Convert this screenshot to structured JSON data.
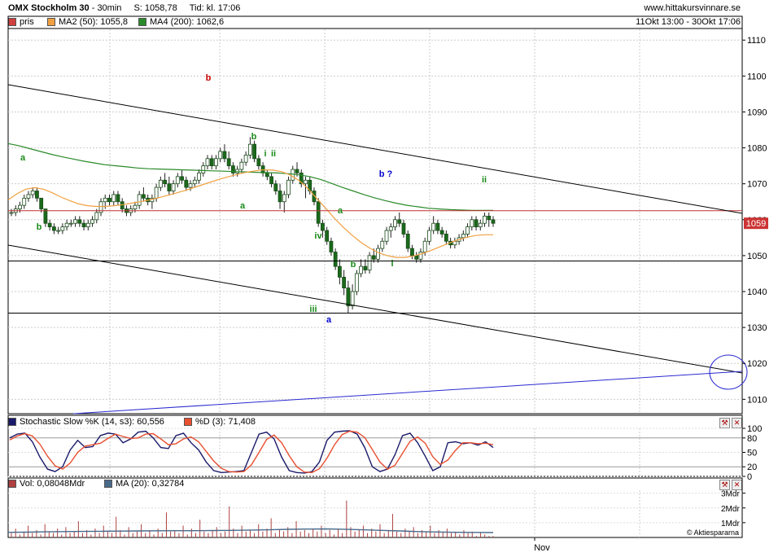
{
  "header": {
    "instrument": "OMX Stockholm 30",
    "interval": "30min",
    "last": "S: 1058,78",
    "time": "Tid: kl. 17:06",
    "site": "www.hittakursvinnare.se",
    "range": "11Okt 13:00 - 30Okt 17:06"
  },
  "legend": {
    "price": {
      "label": "pris",
      "color": "#cc3333"
    },
    "ma50": {
      "label": "MA2 (50): 1055,8",
      "color": "#f0a040"
    },
    "ma200": {
      "label": "MA4 (200): 1062,6",
      "color": "#2a8a2a"
    }
  },
  "price_badge": "1059",
  "stoch_legend": {
    "k": "Stochastic Slow %K (14, s3): 60,556",
    "d": "%D (3): 71,408"
  },
  "vol_legend": {
    "vol": "Vol: 0,08048Mdr",
    "ma": "MA (20): 0,32784"
  },
  "x_label": "Nov",
  "credit": "© Aktiespararna",
  "icons": {
    "settings": "wrench-icon",
    "close": "close-icon"
  },
  "chart_data": [
    {
      "type": "candlestick",
      "title": "OMX Stockholm 30",
      "ylim": [
        1006,
        1113
      ],
      "yticks": [
        1010,
        1020,
        1030,
        1040,
        1050,
        1060,
        1070,
        1080,
        1090,
        1100,
        1110
      ],
      "grid": true,
      "x_tick_labels": [
        "Nov"
      ],
      "candles": [
        [
          1062,
          1063,
          1061,
          1062
        ],
        [
          1062,
          1064,
          1061,
          1063
        ],
        [
          1063,
          1065,
          1062,
          1064
        ],
        [
          1064,
          1067,
          1063,
          1066
        ],
        [
          1066,
          1068,
          1065,
          1067
        ],
        [
          1067,
          1069,
          1066,
          1068
        ],
        [
          1068,
          1069,
          1065,
          1066
        ],
        [
          1066,
          1066,
          1062,
          1063
        ],
        [
          1063,
          1063,
          1058,
          1059
        ],
        [
          1059,
          1060,
          1057,
          1058
        ],
        [
          1058,
          1059,
          1056,
          1057
        ],
        [
          1057,
          1058,
          1056,
          1057
        ],
        [
          1057,
          1059,
          1056,
          1058
        ],
        [
          1058,
          1060,
          1057,
          1059
        ],
        [
          1059,
          1060,
          1058,
          1059
        ],
        [
          1059,
          1061,
          1058,
          1060
        ],
        [
          1060,
          1061,
          1058,
          1059
        ],
        [
          1059,
          1060,
          1057,
          1058
        ],
        [
          1058,
          1060,
          1057,
          1059
        ],
        [
          1059,
          1061,
          1058,
          1060
        ],
        [
          1060,
          1063,
          1059,
          1062
        ],
        [
          1062,
          1066,
          1061,
          1065
        ],
        [
          1065,
          1067,
          1063,
          1066
        ],
        [
          1066,
          1067,
          1064,
          1065
        ],
        [
          1065,
          1068,
          1064,
          1067
        ],
        [
          1067,
          1068,
          1064,
          1065
        ],
        [
          1065,
          1066,
          1062,
          1063
        ],
        [
          1063,
          1064,
          1061,
          1062
        ],
        [
          1062,
          1064,
          1061,
          1063
        ],
        [
          1063,
          1065,
          1062,
          1064
        ],
        [
          1064,
          1068,
          1063,
          1067
        ],
        [
          1067,
          1069,
          1065,
          1066
        ],
        [
          1066,
          1067,
          1064,
          1065
        ],
        [
          1065,
          1067,
          1063,
          1066
        ],
        [
          1066,
          1070,
          1065,
          1069
        ],
        [
          1069,
          1072,
          1068,
          1071
        ],
        [
          1071,
          1073,
          1069,
          1070
        ],
        [
          1070,
          1072,
          1067,
          1068
        ],
        [
          1068,
          1071,
          1067,
          1070
        ],
        [
          1070,
          1073,
          1069,
          1072
        ],
        [
          1072,
          1074,
          1070,
          1071
        ],
        [
          1071,
          1072,
          1068,
          1069
        ],
        [
          1069,
          1071,
          1068,
          1070
        ],
        [
          1070,
          1072,
          1069,
          1071
        ],
        [
          1071,
          1074,
          1070,
          1073
        ],
        [
          1073,
          1076,
          1072,
          1075
        ],
        [
          1075,
          1078,
          1074,
          1077
        ],
        [
          1077,
          1078,
          1074,
          1075
        ],
        [
          1075,
          1078,
          1074,
          1077
        ],
        [
          1077,
          1080,
          1076,
          1079
        ],
        [
          1079,
          1081,
          1076,
          1077
        ],
        [
          1077,
          1079,
          1074,
          1075
        ],
        [
          1075,
          1076,
          1072,
          1073
        ],
        [
          1073,
          1075,
          1072,
          1074
        ],
        [
          1074,
          1077,
          1073,
          1076
        ],
        [
          1076,
          1079,
          1075,
          1078
        ],
        [
          1078,
          1083,
          1077,
          1081
        ],
        [
          1081,
          1082,
          1076,
          1077
        ],
        [
          1077,
          1078,
          1074,
          1075
        ],
        [
          1075,
          1076,
          1072,
          1073
        ],
        [
          1073,
          1074,
          1071,
          1072
        ],
        [
          1072,
          1073,
          1069,
          1070
        ],
        [
          1070,
          1071,
          1067,
          1068
        ],
        [
          1068,
          1070,
          1063,
          1065
        ],
        [
          1065,
          1068,
          1062,
          1067
        ],
        [
          1067,
          1072,
          1066,
          1071
        ],
        [
          1071,
          1075,
          1070,
          1074
        ],
        [
          1074,
          1076,
          1072,
          1073
        ],
        [
          1073,
          1074,
          1069,
          1070
        ],
        [
          1070,
          1072,
          1066,
          1071
        ],
        [
          1071,
          1072,
          1067,
          1068
        ],
        [
          1068,
          1069,
          1064,
          1065
        ],
        [
          1065,
          1066,
          1058,
          1059
        ],
        [
          1059,
          1060,
          1055,
          1057
        ],
        [
          1057,
          1058,
          1053,
          1054
        ],
        [
          1054,
          1055,
          1050,
          1051
        ],
        [
          1051,
          1052,
          1046,
          1047
        ],
        [
          1047,
          1049,
          1042,
          1044
        ],
        [
          1044,
          1046,
          1039,
          1041
        ],
        [
          1041,
          1043,
          1034,
          1036
        ],
        [
          1036,
          1042,
          1035,
          1040
        ],
        [
          1040,
          1046,
          1039,
          1045
        ],
        [
          1045,
          1049,
          1044,
          1047
        ],
        [
          1047,
          1049,
          1045,
          1046
        ],
        [
          1046,
          1051,
          1045,
          1050
        ],
        [
          1050,
          1052,
          1048,
          1049
        ],
        [
          1049,
          1053,
          1048,
          1052
        ],
        [
          1052,
          1055,
          1051,
          1054
        ],
        [
          1054,
          1058,
          1053,
          1057
        ],
        [
          1057,
          1059,
          1055,
          1058
        ],
        [
          1058,
          1061,
          1057,
          1060
        ],
        [
          1060,
          1062,
          1058,
          1059
        ],
        [
          1059,
          1060,
          1055,
          1056
        ],
        [
          1056,
          1057,
          1051,
          1052
        ],
        [
          1052,
          1053,
          1049,
          1050
        ],
        [
          1050,
          1051,
          1048,
          1049
        ],
        [
          1049,
          1052,
          1048,
          1051
        ],
        [
          1051,
          1055,
          1050,
          1054
        ],
        [
          1054,
          1058,
          1053,
          1057
        ],
        [
          1057,
          1061,
          1056,
          1059
        ],
        [
          1059,
          1060,
          1056,
          1057
        ],
        [
          1057,
          1058,
          1055,
          1056
        ],
        [
          1056,
          1057,
          1053,
          1054
        ],
        [
          1054,
          1055,
          1052,
          1053
        ],
        [
          1053,
          1055,
          1052,
          1054
        ],
        [
          1054,
          1056,
          1053,
          1055
        ],
        [
          1055,
          1057,
          1054,
          1056
        ],
        [
          1056,
          1059,
          1055,
          1058
        ],
        [
          1058,
          1061,
          1057,
          1060
        ],
        [
          1060,
          1061,
          1057,
          1058
        ],
        [
          1058,
          1060,
          1057,
          1059
        ],
        [
          1059,
          1062,
          1058,
          1061
        ],
        [
          1061,
          1062,
          1058,
          1060
        ],
        [
          1060,
          1061,
          1058,
          1059
        ]
      ],
      "ma50": [
        1065.5,
        1067.2,
        1068.5,
        1068.9,
        1068.5,
        1067.5,
        1066.3,
        1065.3,
        1064.4,
        1063.9,
        1063.7,
        1063.7,
        1063.9,
        1064.2,
        1064.6,
        1065.0,
        1065.5,
        1066.1,
        1066.7,
        1067.4,
        1068.1,
        1068.9,
        1069.7,
        1070.5,
        1071.3,
        1072.0,
        1072.6,
        1073.2,
        1073.6,
        1073.9,
        1073.8,
        1073.4,
        1072.4,
        1070.9,
        1068.7,
        1065.9,
        1063.2,
        1060.4,
        1057.9,
        1055.7,
        1053.7,
        1052.1,
        1050.8,
        1050.0,
        1049.5,
        1049.5,
        1049.9,
        1050.6,
        1051.5,
        1052.5,
        1053.5,
        1054.4,
        1055.1,
        1055.6,
        1055.8,
        1055.8
      ],
      "ma200": [
        1081.2,
        1080.6,
        1079.8,
        1079.0,
        1078.2,
        1077.5,
        1076.9,
        1076.3,
        1075.8,
        1075.3,
        1075.0,
        1074.7,
        1074.4,
        1074.2,
        1074.1,
        1074.0,
        1073.9,
        1073.8,
        1073.7,
        1073.6,
        1073.5,
        1073.4,
        1073.3,
        1073.2,
        1073.1,
        1073.0,
        1072.8,
        1072.5,
        1072.0,
        1071.2,
        1070.1,
        1069.0,
        1068.0,
        1067.0,
        1066.1,
        1065.3,
        1064.6,
        1064.0,
        1063.6,
        1063.2,
        1063.0,
        1062.8,
        1062.7,
        1062.6,
        1062.6,
        1062.6
      ],
      "horizontal_lines": [
        1062.5,
        1048.5,
        1034.0
      ],
      "wave_labels": [
        {
          "text": "a",
          "color": "#1a8a1a"
        },
        {
          "text": "b",
          "color": "#1a8a1a"
        },
        {
          "text": "b",
          "color": "#cc0000"
        },
        {
          "text": "a",
          "color": "#1a8a1a"
        },
        {
          "text": "b",
          "color": "#1a8a1a"
        },
        {
          "text": "i",
          "color": "#1a8a1a"
        },
        {
          "text": "ii",
          "color": "#1a8a1a"
        },
        {
          "text": "iii",
          "color": "#1a8a1a"
        },
        {
          "text": "iv",
          "color": "#1a8a1a"
        },
        {
          "text": "a",
          "color": "#0000cc"
        },
        {
          "text": "a",
          "color": "#1a8a1a"
        },
        {
          "text": "b",
          "color": "#1a8a1a"
        },
        {
          "text": "i",
          "color": "#1a8a1a"
        },
        {
          "text": "b ?",
          "color": "#0000cc"
        },
        {
          "text": "ii",
          "color": "#1a8a1a"
        }
      ]
    },
    {
      "type": "line",
      "title": "Stochastic Slow %K (14, s3)",
      "ylim": [
        0,
        100
      ],
      "yticks": [
        0,
        20,
        50,
        80,
        100
      ],
      "series": [
        {
          "name": "Stochastic Slow %K (14, s3): 60,556",
          "color": "#1a1a6a",
          "values": [
            80,
            88,
            90,
            72,
            40,
            15,
            10,
            20,
            55,
            75,
            60,
            62,
            85,
            90,
            88,
            70,
            78,
            92,
            94,
            80,
            60,
            58,
            85,
            90,
            70,
            55,
            30,
            12,
            8,
            9,
            10,
            12,
            50,
            88,
            92,
            78,
            40,
            12,
            8,
            7,
            10,
            30,
            75,
            92,
            94,
            95,
            88,
            60,
            20,
            10,
            15,
            45,
            85,
            90,
            70,
            42,
            12,
            20,
            70,
            72,
            68,
            70,
            65,
            72,
            60
          ]
        },
        {
          "name": "%D (3): 71,408",
          "color": "#e85030",
          "values": [
            76,
            84,
            89,
            84,
            67,
            42,
            22,
            15,
            28,
            50,
            63,
            66,
            69,
            79,
            88,
            83,
            79,
            80,
            88,
            89,
            78,
            66,
            68,
            78,
            82,
            72,
            52,
            32,
            17,
            10,
            9,
            10,
            24,
            50,
            77,
            86,
            70,
            43,
            20,
            9,
            8,
            16,
            38,
            66,
            87,
            94,
            92,
            81,
            56,
            30,
            15,
            23,
            48,
            73,
            82,
            69,
            41,
            25,
            34,
            54,
            70,
            70,
            68,
            69,
            66
          ]
        }
      ]
    },
    {
      "type": "bar",
      "title": "Vol",
      "yticks_labels": [
        "1Mdr",
        "2Mdr",
        "3Mdr"
      ],
      "ylim": [
        0,
        3.2
      ],
      "series": [
        {
          "name": "Vol: 0,08048Mdr",
          "color": "#b04040",
          "values": [
            0.3,
            0.6,
            0.2,
            0.4,
            0.8,
            0.3,
            0.5,
            0.2,
            0.9,
            0.4,
            0.3,
            0.6,
            0.2,
            0.7,
            0.3,
            0.4,
            1.1,
            0.3,
            0.5,
            0.2,
            0.6,
            0.3,
            0.8,
            0.4,
            0.3,
            1.4,
            0.5,
            0.2,
            0.7,
            0.3,
            0.4,
            0.9,
            0.3,
            0.5,
            0.2,
            0.6,
            0.3,
            1.7,
            0.4,
            0.5,
            0.3,
            0.8,
            0.2,
            0.6,
            0.3,
            1.2,
            0.4,
            0.3,
            0.5,
            0.7,
            0.3,
            0.4,
            2.1,
            0.6,
            0.3,
            0.8,
            0.4,
            0.5,
            0.3,
            0.9,
            0.4,
            0.6,
            1.3,
            0.3,
            0.5,
            0.4,
            0.7,
            0.3,
            1.1,
            0.4,
            0.5,
            0.3,
            0.6,
            0.4,
            0.8,
            0.3,
            0.5,
            0.2,
            0.6,
            0.3,
            2.5,
            0.7,
            0.4,
            0.5,
            0.8,
            0.3,
            0.6,
            0.4,
            0.9,
            0.3,
            0.5,
            1.6,
            0.4,
            0.3,
            0.6,
            0.4,
            0.7,
            0.3,
            0.5,
            0.4,
            0.8,
            0.3,
            0.5,
            0.4,
            0.6,
            0.3,
            0.4,
            0.2,
            0.5,
            0.3,
            0.4,
            0.1,
            0.3,
            0.2,
            0.1,
            0.1
          ]
        },
        {
          "name": "MA (20): 0,32784",
          "color": "#4a6a8a",
          "values": [
            0.35,
            0.36,
            0.38,
            0.4,
            0.41,
            0.42,
            0.43,
            0.44,
            0.45,
            0.46,
            0.46,
            0.47,
            0.48,
            0.5,
            0.52,
            0.55,
            0.57,
            0.58,
            0.56,
            0.52,
            0.48,
            0.44,
            0.4,
            0.37,
            0.35,
            0.34,
            0.33
          ]
        }
      ]
    }
  ]
}
